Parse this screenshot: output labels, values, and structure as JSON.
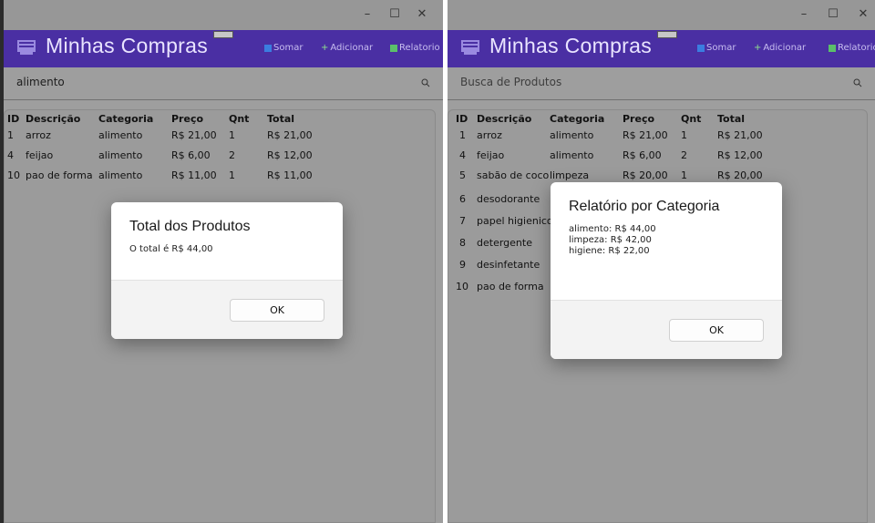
{
  "app": {
    "title": "Minhas Compras",
    "buttons": {
      "somar": "Somar",
      "adicionar": "Adicionar",
      "relatorio": "Relatorio"
    },
    "accent": "#4a2fa3"
  },
  "window_controls": {
    "minimize": "–",
    "maximize": "☐",
    "close": "✕"
  },
  "table": {
    "columns": [
      "ID",
      "Descrição",
      "Categoria",
      "Preço",
      "Qnt",
      "Total"
    ]
  },
  "left": {
    "search_value": "alimento",
    "search_placeholder": "Busca de Produtos",
    "rows": [
      {
        "id": "1",
        "desc": "arroz",
        "cat": "alimento",
        "preco": "R$ 21,00",
        "qnt": "1",
        "total": "R$ 21,00"
      },
      {
        "id": "4",
        "desc": "feijao",
        "cat": "alimento",
        "preco": "R$ 6,00",
        "qnt": "2",
        "total": "R$ 12,00"
      },
      {
        "id": "10",
        "desc": "pao de forma",
        "cat": "alimento",
        "preco": "R$ 11,00",
        "qnt": "1",
        "total": "R$ 11,00"
      }
    ],
    "dialog": {
      "title": "Total dos Produtos",
      "message": "O total é R$ 44,00",
      "ok": "OK"
    }
  },
  "right": {
    "search_value": "",
    "search_placeholder": "Busca de Produtos",
    "rows": [
      {
        "id": "1",
        "desc": "arroz",
        "cat": "alimento",
        "preco": "R$ 21,00",
        "qnt": "1",
        "total": "R$ 21,00"
      },
      {
        "id": "4",
        "desc": "feijao",
        "cat": "alimento",
        "preco": "R$ 6,00",
        "qnt": "2",
        "total": "R$ 12,00"
      },
      {
        "id": "5",
        "desc": "sabão de coco",
        "cat": "limpeza",
        "preco": "R$ 20,00",
        "qnt": "1",
        "total": "R$ 20,00"
      },
      {
        "id": "6",
        "desc": "desodorante",
        "cat": "",
        "preco": "",
        "qnt": "",
        "total": ""
      },
      {
        "id": "7",
        "desc": "papel higienico",
        "cat": "",
        "preco": "",
        "qnt": "",
        "total": ""
      },
      {
        "id": "8",
        "desc": "detergente",
        "cat": "",
        "preco": "",
        "qnt": "",
        "total": ""
      },
      {
        "id": "9",
        "desc": "desinfetante",
        "cat": "",
        "preco": "",
        "qnt": "",
        "total": ""
      },
      {
        "id": "10",
        "desc": "pao de forma",
        "cat": "",
        "preco": "",
        "qnt": "",
        "total": ""
      }
    ],
    "dialog": {
      "title": "Relatório por Categoria",
      "lines": [
        "alimento: R$ 44,00",
        "limpeza: R$ 42,00",
        "higiene: R$ 22,00"
      ],
      "ok": "OK"
    }
  }
}
